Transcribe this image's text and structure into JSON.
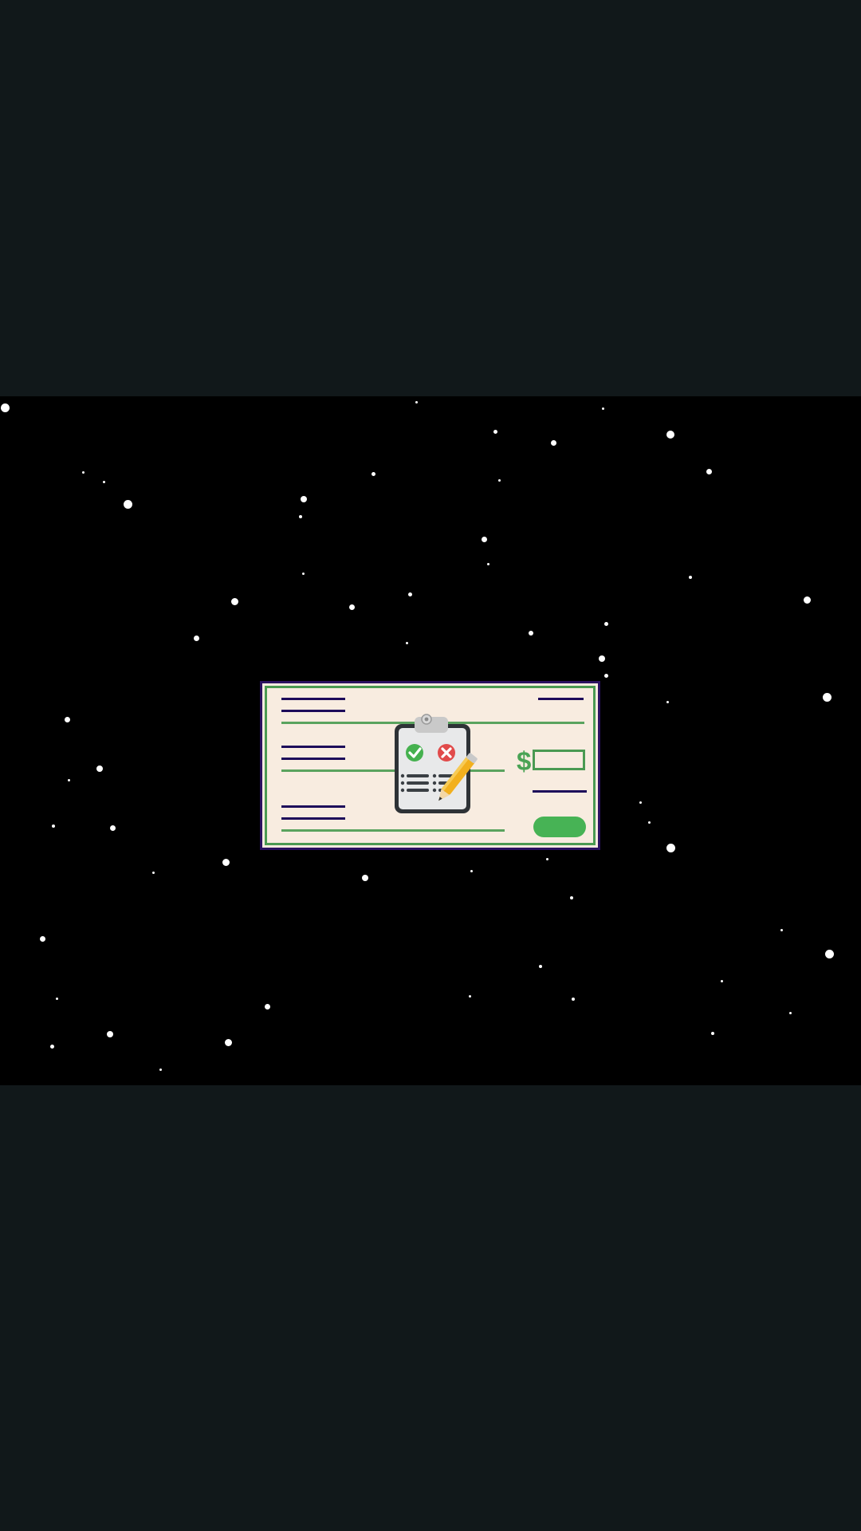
{
  "scene": {
    "description_free": true,
    "icons": {
      "clipboard": "clipboard-checklist-icon",
      "pencil": "pencil-icon",
      "check": "check-mark-icon",
      "cross": "cross-mark-icon"
    },
    "currency_symbol": "$",
    "colors": {
      "frame": "#2a1160",
      "paper": "#f8ece0",
      "border_green": "#4a9a52",
      "line_navy": "#1d0a5a",
      "pill_green": "#47b355",
      "background": "#000000",
      "letterbox": "#11181a"
    }
  }
}
